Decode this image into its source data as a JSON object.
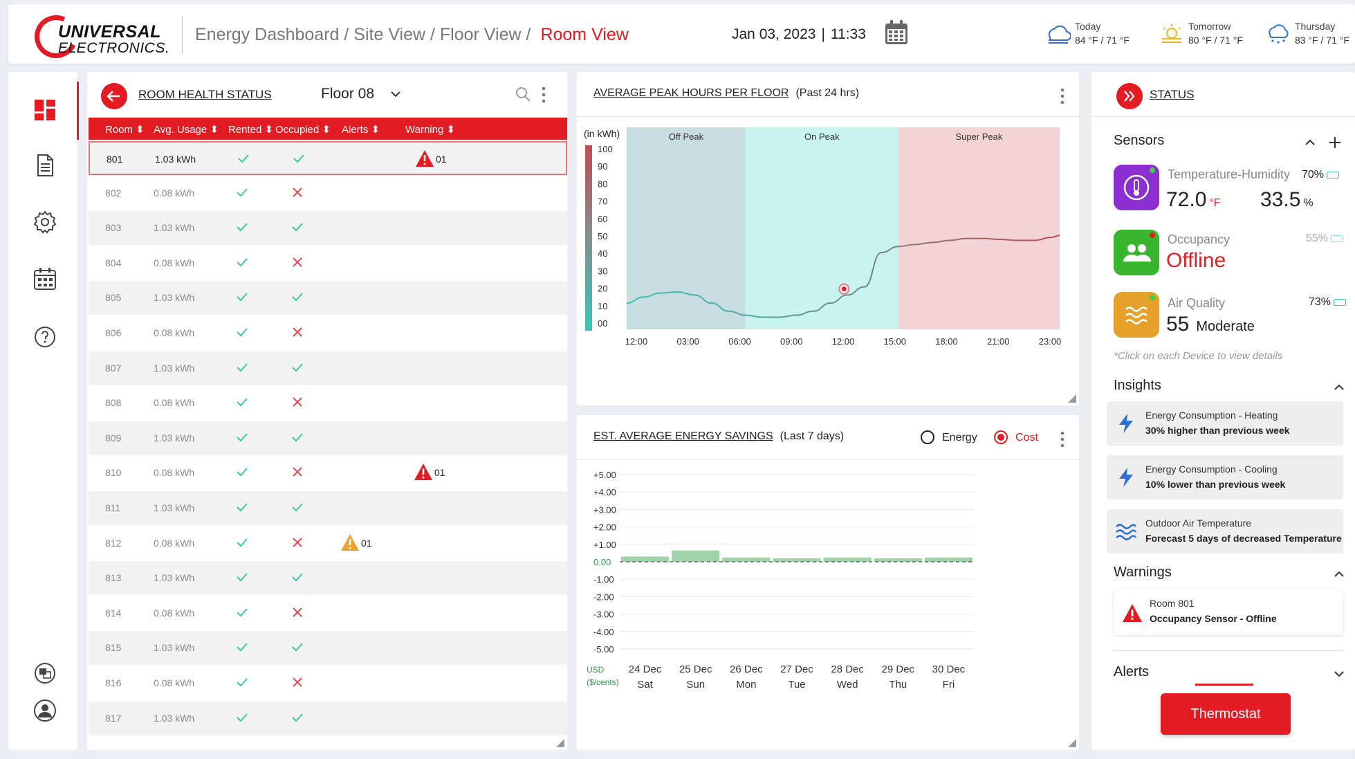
{
  "brand": {
    "line1": "UNIVERSAL",
    "line2": "ELECTRONICS."
  },
  "breadcrumb": {
    "path": "Energy Dashboard / Site View / Floor View /",
    "active": "Room View"
  },
  "datetime": {
    "date": "Jan 03, 2023",
    "separator": "|",
    "time": "11:33"
  },
  "weather": [
    {
      "day": "Today",
      "temp": "84 °F / 71 °F",
      "icon": "cloudy-icon"
    },
    {
      "day": "Tomorrow",
      "temp": "80 °F / 71 °F",
      "icon": "partly-sunny-icon"
    },
    {
      "day": "Thursday",
      "temp": "83 °F / 71 °F",
      "icon": "snow-icon"
    }
  ],
  "sidebar": {
    "items": [
      {
        "name": "dashboard-icon"
      },
      {
        "name": "document-icon"
      },
      {
        "name": "settings-icon"
      },
      {
        "name": "calendar-icon"
      },
      {
        "name": "help-icon"
      },
      {
        "name": "translate-icon"
      },
      {
        "name": "profile-icon"
      }
    ]
  },
  "room_health": {
    "title": "ROOM HEALTH STATUS",
    "floor": "Floor 08",
    "columns": [
      "Room",
      "Avg. Usage",
      "Rented",
      "Occupied",
      "Alerts",
      "Warning"
    ],
    "rows": [
      {
        "room": "801",
        "usage": "1.03 kWh",
        "rented": true,
        "occupied": true,
        "alerts": "",
        "warning": "01"
      },
      {
        "room": "802",
        "usage": "0.08 kWh",
        "rented": true,
        "occupied": false,
        "alerts": "",
        "warning": ""
      },
      {
        "room": "803",
        "usage": "1.03 kWh",
        "rented": true,
        "occupied": true,
        "alerts": "",
        "warning": ""
      },
      {
        "room": "804",
        "usage": "0.08 kWh",
        "rented": true,
        "occupied": false,
        "alerts": "",
        "warning": ""
      },
      {
        "room": "805",
        "usage": "1.03 kWh",
        "rented": true,
        "occupied": true,
        "alerts": "",
        "warning": ""
      },
      {
        "room": "806",
        "usage": "0.08 kWh",
        "rented": true,
        "occupied": false,
        "alerts": "",
        "warning": ""
      },
      {
        "room": "807",
        "usage": "1.03 kWh",
        "rented": true,
        "occupied": true,
        "alerts": "",
        "warning": ""
      },
      {
        "room": "808",
        "usage": "0.08 kWh",
        "rented": true,
        "occupied": false,
        "alerts": "",
        "warning": ""
      },
      {
        "room": "809",
        "usage": "1.03 kWh",
        "rented": true,
        "occupied": true,
        "alerts": "",
        "warning": ""
      },
      {
        "room": "810",
        "usage": "0.08 kWh",
        "rented": true,
        "occupied": false,
        "alerts": "",
        "warning": "01"
      },
      {
        "room": "811",
        "usage": "1.03 kWh",
        "rented": true,
        "occupied": true,
        "alerts": "",
        "warning": ""
      },
      {
        "room": "812",
        "usage": "0.08 kWh",
        "rented": true,
        "occupied": false,
        "alerts": "01",
        "warning": ""
      },
      {
        "room": "813",
        "usage": "1.03 kWh",
        "rented": true,
        "occupied": true,
        "alerts": "",
        "warning": ""
      },
      {
        "room": "814",
        "usage": "0.08 kWh",
        "rented": true,
        "occupied": false,
        "alerts": "",
        "warning": ""
      },
      {
        "room": "815",
        "usage": "1.03 kWh",
        "rented": true,
        "occupied": true,
        "alerts": "",
        "warning": ""
      },
      {
        "room": "816",
        "usage": "0.08 kWh",
        "rented": true,
        "occupied": false,
        "alerts": "",
        "warning": ""
      },
      {
        "room": "817",
        "usage": "1.03 kWh",
        "rented": true,
        "occupied": true,
        "alerts": "",
        "warning": ""
      }
    ]
  },
  "peak_chart_header": {
    "title": "AVERAGE PEAK HOURS PER FLOOR",
    "subtitle": "(Past 24 hrs)"
  },
  "savings_chart_header": {
    "title": "EST. AVERAGE ENERGY SAVINGS",
    "subtitle": "(Last 7 days)",
    "toggle": {
      "energy": "Energy",
      "cost": "Cost",
      "selected": "Cost"
    }
  },
  "chart_data": [
    {
      "type": "line",
      "ylabel": "(in kWh)",
      "ylim": [
        0,
        100
      ],
      "yticks": [
        "00",
        "10",
        "20",
        "30",
        "40",
        "50",
        "60",
        "70",
        "80",
        "90",
        "100"
      ],
      "xticks": [
        "12:00",
        "03:00",
        "06:00",
        "09:00",
        "12:00",
        "15:00",
        "18:00",
        "21:00",
        "23:00"
      ],
      "bands": [
        {
          "label": "Off Peak",
          "from": 0,
          "to": 7,
          "color": "#c8dde0"
        },
        {
          "label": "On Peak",
          "from": 7,
          "to": 16,
          "color": "#c9f3ef"
        },
        {
          "label": "Super Peak",
          "from": 16,
          "to": 25.5,
          "color": "#f3d3d5"
        }
      ],
      "colorbar": [
        "#37c7b8",
        "#8a8a8a",
        "#c24a55"
      ],
      "series": [
        {
          "hours": [
            0,
            1,
            2,
            3,
            4,
            5,
            6,
            7,
            8,
            9,
            10,
            11,
            12,
            13,
            14,
            15,
            16,
            17,
            18,
            19,
            20,
            21,
            22,
            23,
            24,
            25,
            25.5
          ],
          "values": [
            13,
            16,
            18,
            18.5,
            17,
            13,
            9,
            7,
            6,
            6,
            7,
            9,
            13,
            17,
            21,
            38,
            41,
            42,
            43,
            44,
            45,
            45,
            44.5,
            44,
            44,
            45.5,
            46.5
          ]
        }
      ],
      "highlight": {
        "hour": 12.8,
        "value": 20
      }
    },
    {
      "type": "bar",
      "ylabel": "USD ($/cents)",
      "ylim": [
        -5,
        5
      ],
      "yticks": [
        "-5.00",
        "-4.00",
        "-3.00",
        "-2.00",
        "-1.00",
        "0.00",
        "+1.00",
        "+2.00",
        "+3.00",
        "+4.00",
        "+5.00"
      ],
      "categories": [
        "24 Dec Sat",
        "25 Dec Sun",
        "26 Dec Mon",
        "27 Dec Tue",
        "28 Dec Wed",
        "29 Dec Thu",
        "30 Dec Fri"
      ],
      "days": [
        "24 Dec",
        "25 Dec",
        "26 Dec",
        "27 Dec",
        "28 Dec",
        "29 Dec",
        "30 Dec"
      ],
      "weekdays": [
        "Sat",
        "Sun",
        "Mon",
        "Tue",
        "Wed",
        "Thu",
        "Fri"
      ],
      "values": [
        0.3,
        0.65,
        0.25,
        0.2,
        0.25,
        0.2,
        0.25
      ],
      "bar_color": "#9fd3a9",
      "zero_color": "#2e9a48"
    }
  ],
  "status": {
    "title": "STATUS",
    "sensors_heading": "Sensors",
    "sensors": [
      {
        "name": "Temperature-Humidity",
        "battery": "70%",
        "value1": "72.0",
        "unit1": "°F",
        "value2": "33.5",
        "unit2": "%",
        "color": "#8b2fd0",
        "icon": "thermometer-icon"
      },
      {
        "name": "Occupancy",
        "battery": "55%",
        "value1": "Offline",
        "color": "#38b52c",
        "icon": "people-icon"
      },
      {
        "name": "Air Quality",
        "battery": "73%",
        "value1": "55",
        "value2": "Moderate",
        "color": "#e5a12a",
        "icon": "air-waves-icon"
      }
    ],
    "sensor_note": "*Click on each Device to view details",
    "insights_heading": "Insights",
    "insights": [
      {
        "line1": "Energy Consumption - Heating",
        "line2": "30% higher than previous week",
        "icon": "lightning-icon"
      },
      {
        "line1": "Energy Consumption - Cooling",
        "line2": "10% lower than previous week",
        "icon": "lightning-icon"
      },
      {
        "line1": "Outdoor Air Temperature",
        "line2": "Forecast 5 days of decreased Temperature",
        "icon": "air-waves-icon"
      }
    ],
    "warnings_heading": "Warnings",
    "warning": {
      "line1": "Room 801",
      "line2": "Occupancy Sensor - Offline"
    },
    "alerts_heading": "Alerts",
    "thermostat_label": "Thermostat"
  },
  "colors": {
    "accent": "#e31b23",
    "check": "#3ec6a6",
    "cross": "#e8474f",
    "alert": "#f0a030"
  }
}
